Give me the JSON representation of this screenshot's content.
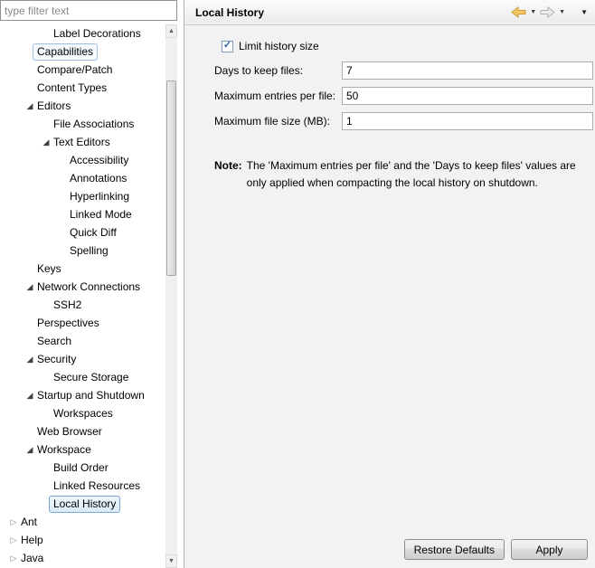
{
  "filter": {
    "placeholder": "type filter text"
  },
  "icons": {
    "dropdown": "▼",
    "check": "✓",
    "scroll_up": "▲",
    "scroll_down": "▼",
    "tree_expanded": "◢",
    "tree_collapsed": "▷"
  },
  "tree": {
    "items": [
      {
        "label": "Label Decorations",
        "level": 2,
        "arrow": "none"
      },
      {
        "label": "Capabilities",
        "level": 1,
        "arrow": "none",
        "focus": true
      },
      {
        "label": "Compare/Patch",
        "level": 1,
        "arrow": "none"
      },
      {
        "label": "Content Types",
        "level": 1,
        "arrow": "none"
      },
      {
        "label": "Editors",
        "level": 1,
        "arrow": "expanded"
      },
      {
        "label": "File Associations",
        "level": 2,
        "arrow": "none"
      },
      {
        "label": "Text Editors",
        "level": 2,
        "arrow": "expanded"
      },
      {
        "label": "Accessibility",
        "level": 3,
        "arrow": "none"
      },
      {
        "label": "Annotations",
        "level": 3,
        "arrow": "none"
      },
      {
        "label": "Hyperlinking",
        "level": 3,
        "arrow": "none"
      },
      {
        "label": "Linked Mode",
        "level": 3,
        "arrow": "none"
      },
      {
        "label": "Quick Diff",
        "level": 3,
        "arrow": "none"
      },
      {
        "label": "Spelling",
        "level": 3,
        "arrow": "none"
      },
      {
        "label": "Keys",
        "level": 1,
        "arrow": "none"
      },
      {
        "label": "Network Connections",
        "level": 1,
        "arrow": "expanded"
      },
      {
        "label": "SSH2",
        "level": 2,
        "arrow": "none"
      },
      {
        "label": "Perspectives",
        "level": 1,
        "arrow": "none"
      },
      {
        "label": "Search",
        "level": 1,
        "arrow": "none"
      },
      {
        "label": "Security",
        "level": 1,
        "arrow": "expanded"
      },
      {
        "label": "Secure Storage",
        "level": 2,
        "arrow": "none"
      },
      {
        "label": "Startup and Shutdown",
        "level": 1,
        "arrow": "expanded"
      },
      {
        "label": "Workspaces",
        "level": 2,
        "arrow": "none"
      },
      {
        "label": "Web Browser",
        "level": 1,
        "arrow": "none"
      },
      {
        "label": "Workspace",
        "level": 1,
        "arrow": "expanded"
      },
      {
        "label": "Build Order",
        "level": 2,
        "arrow": "none"
      },
      {
        "label": "Linked Resources",
        "level": 2,
        "arrow": "none"
      },
      {
        "label": "Local History",
        "level": 2,
        "arrow": "none",
        "selected": true
      },
      {
        "label": "Ant",
        "level": 0,
        "arrow": "collapsed"
      },
      {
        "label": "Help",
        "level": 0,
        "arrow": "collapsed"
      },
      {
        "label": "Java",
        "level": 0,
        "arrow": "collapsed"
      }
    ]
  },
  "page": {
    "title": "Local History",
    "checkbox": {
      "label": "Limit history size",
      "checked": true
    },
    "fields": [
      {
        "label": "Days to keep files:",
        "value": "7"
      },
      {
        "label": "Maximum entries per file:",
        "value": "50"
      },
      {
        "label": "Maximum file size (MB):",
        "value": "1"
      }
    ],
    "note": {
      "label": "Note:",
      "text": "The 'Maximum entries per file' and the 'Days to keep files' values are only applied when compacting the local history on shutdown."
    },
    "buttons": {
      "restore": "Restore Defaults",
      "apply": "Apply"
    }
  }
}
